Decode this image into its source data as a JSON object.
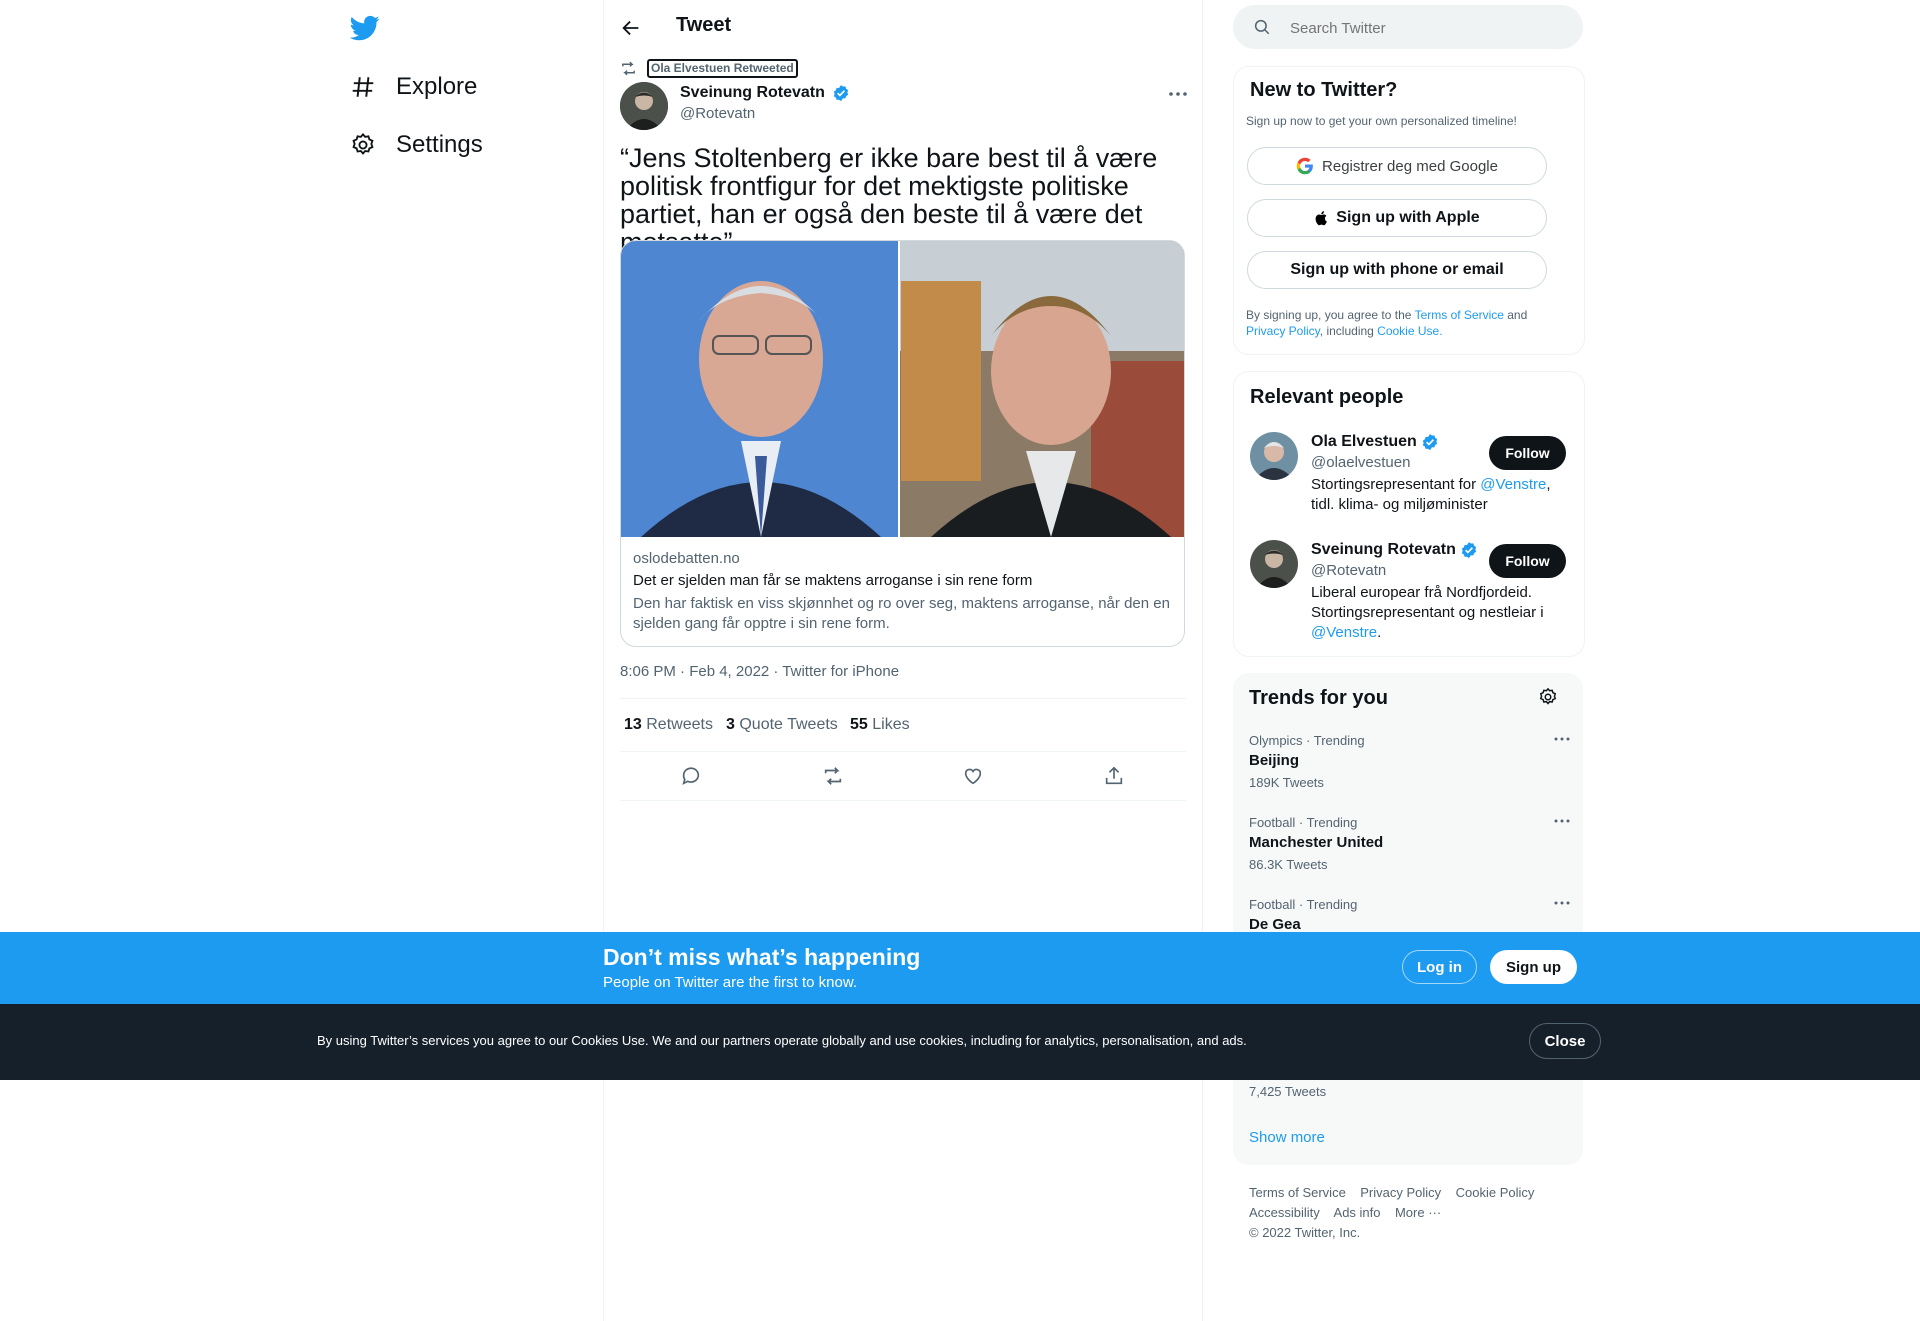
{
  "nav": {
    "logo": "twitter-bird",
    "explore_label": "Explore",
    "settings_label": "Settings"
  },
  "header": {
    "title": "Tweet"
  },
  "tweet": {
    "retweeted_by": "Ola Elvestuen Retweeted",
    "author_name": "Sveinung Rotevatn",
    "author_handle": "@Rotevatn",
    "text": "“Jens Stoltenberg er ikke bare best til å være politisk frontfigur for det mektigste politiske partiet, han er også den beste til å være det motsatte”.",
    "card": {
      "domain": "oslodebatten.no",
      "title": "Det er sjelden man får se maktens arroganse i sin rene form",
      "description": "Den har faktisk en viss skjønnhet og ro over seg, maktens arroganse, når den en sjelden gang får opptre i sin rene form."
    },
    "timestamp": "8:06 PM · Feb 4, 2022 · Twitter for iPhone",
    "stats": {
      "retweets_count": "13",
      "retweets_label": "Retweets",
      "quotes_count": "3",
      "quotes_label": "Quote Tweets",
      "likes_count": "55",
      "likes_label": "Likes"
    }
  },
  "search": {
    "placeholder": "Search Twitter"
  },
  "signup": {
    "title": "New to Twitter?",
    "subtitle": "Sign up now to get your own personalized timeline!",
    "google_label": "Registrer deg med Google",
    "apple_label": "Sign up with Apple",
    "phone_label": "Sign up with phone or email",
    "terms_prefix": "By signing up, you agree to the ",
    "terms_link": "Terms of Service",
    "terms_and": " and",
    "privacy_link": "Privacy Policy",
    "including": ", including ",
    "cookie_link": "Cookie Use."
  },
  "relevant": {
    "title": "Relevant people",
    "follow_label": "Follow",
    "people": [
      {
        "name": "Ola Elvestuen",
        "handle": "@olaelvestuen",
        "bio_a": "Stortingsrepresentant for ",
        "bio_link": "@Venstre",
        "bio_b": ",",
        "bio_c": "tidl. klima- og miljøminister"
      },
      {
        "name": "Sveinung Rotevatn",
        "handle": "@Rotevatn",
        "bio_a": "Liberal europear frå Nordfjordeid.",
        "bio_b": "Stortingsrepresentant og nestleiar i",
        "bio_link": "@Venstre",
        "bio_c": "."
      }
    ]
  },
  "trends": {
    "title": "Trends for you",
    "items": [
      {
        "meta": "Olympics · Trending",
        "name": "Beijing",
        "count": "189K Tweets"
      },
      {
        "meta": "Football · Trending",
        "name": "Manchester United",
        "count": "86.3K Tweets"
      },
      {
        "meta": "Football · Trending",
        "name": "De Gea",
        "count": ""
      }
    ],
    "hidden_count": "7,425 Tweets",
    "show_more": "Show more"
  },
  "footer": {
    "terms": "Terms of Service",
    "privacy": "Privacy Policy",
    "cookie": "Cookie Policy",
    "accessibility": "Accessibility",
    "ads": "Ads info",
    "more": "More ···",
    "copyright": "© 2022 Twitter, Inc."
  },
  "banner": {
    "title": "Don’t miss what’s happening",
    "subtitle": "People on Twitter are the first to know.",
    "login_label": "Log in",
    "signup_label": "Sign up"
  },
  "cookie_bar": {
    "text": "By using Twitter’s services you agree to our Cookies Use. We and our partners operate globally and use cookies, including for analytics, personalisation, and ads.",
    "close_label": "Close"
  },
  "colors": {
    "accent": "#1d9bf0",
    "text": "#0f1419",
    "muted": "#536471",
    "cookie_bar_bg": "#15202b"
  }
}
